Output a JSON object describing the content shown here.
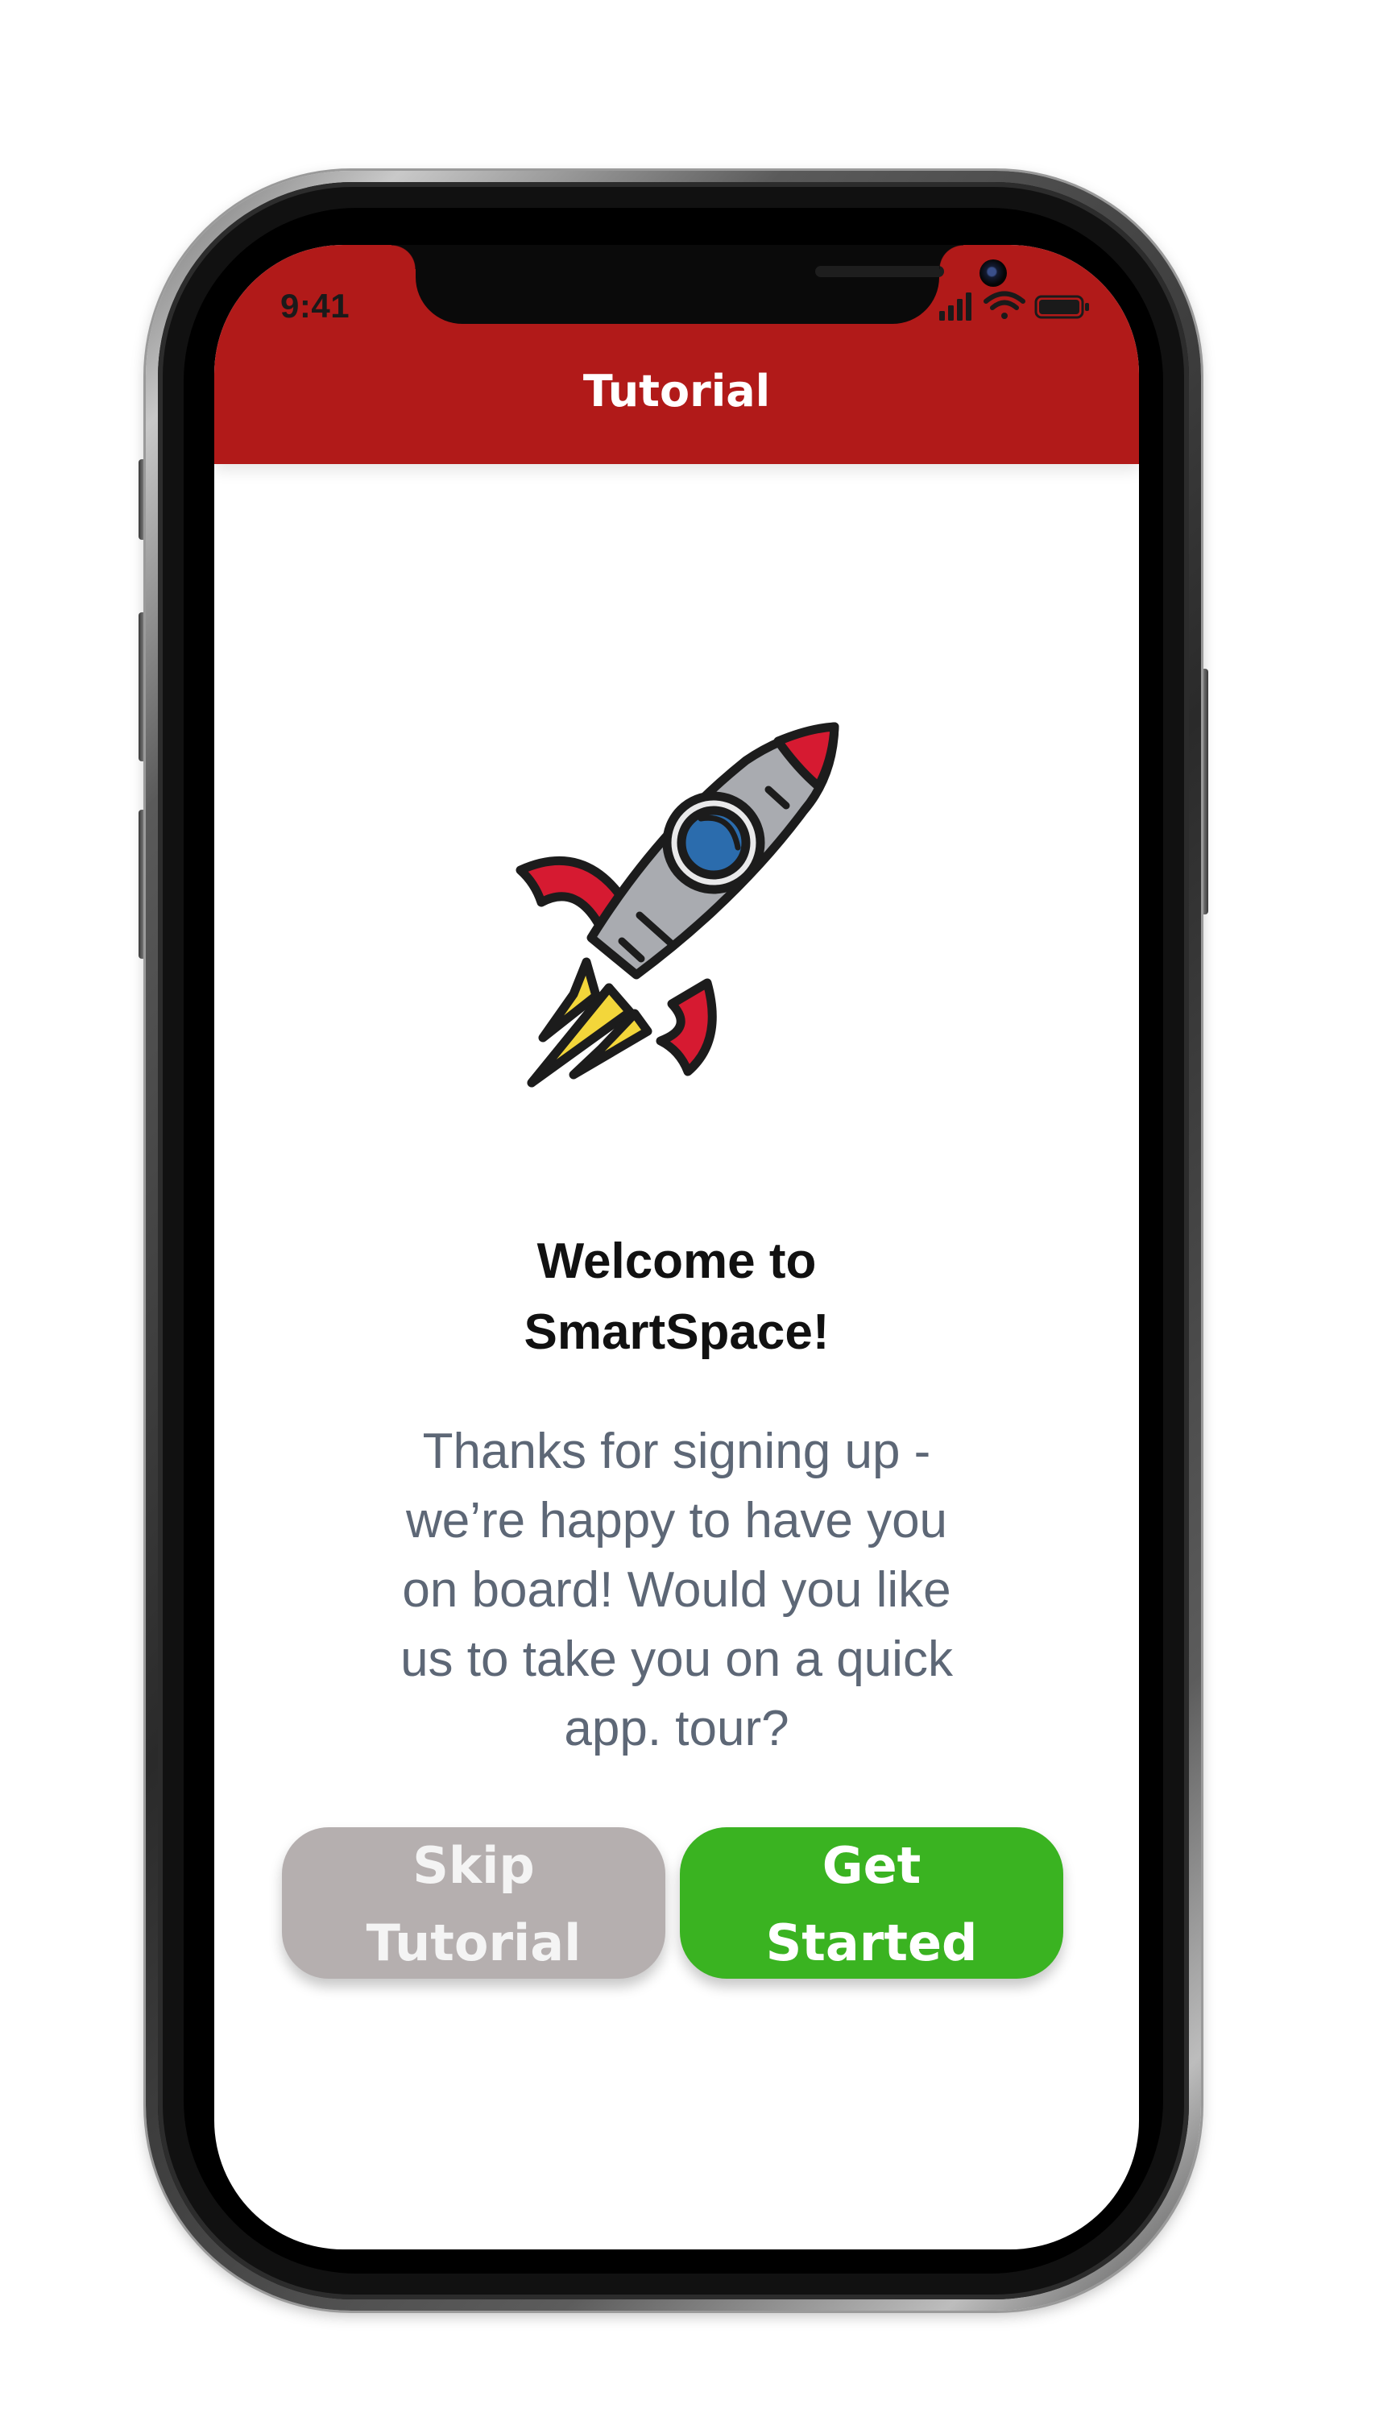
{
  "status_bar": {
    "time": "9:41",
    "icons": [
      "cellular-signal-icon",
      "wifi-icon",
      "battery-icon"
    ]
  },
  "header": {
    "title": "Tutorial",
    "background_color": "#b11a19"
  },
  "hero": {
    "illustration": "rocket-icon"
  },
  "welcome": {
    "title_line1": "Welcome to",
    "title_line2": "SmartSpace!",
    "message_lines": [
      "Thanks for signing up -",
      "we’re happy to have you",
      "on board! Would you like",
      "us to take you on a quick",
      "app. tour?"
    ]
  },
  "actions": {
    "skip": {
      "line1": "Skip",
      "line2": "Tutorial",
      "color": "#b5afaf"
    },
    "start": {
      "line1": "Get",
      "line2": "Started",
      "color": "#3ab321"
    }
  }
}
